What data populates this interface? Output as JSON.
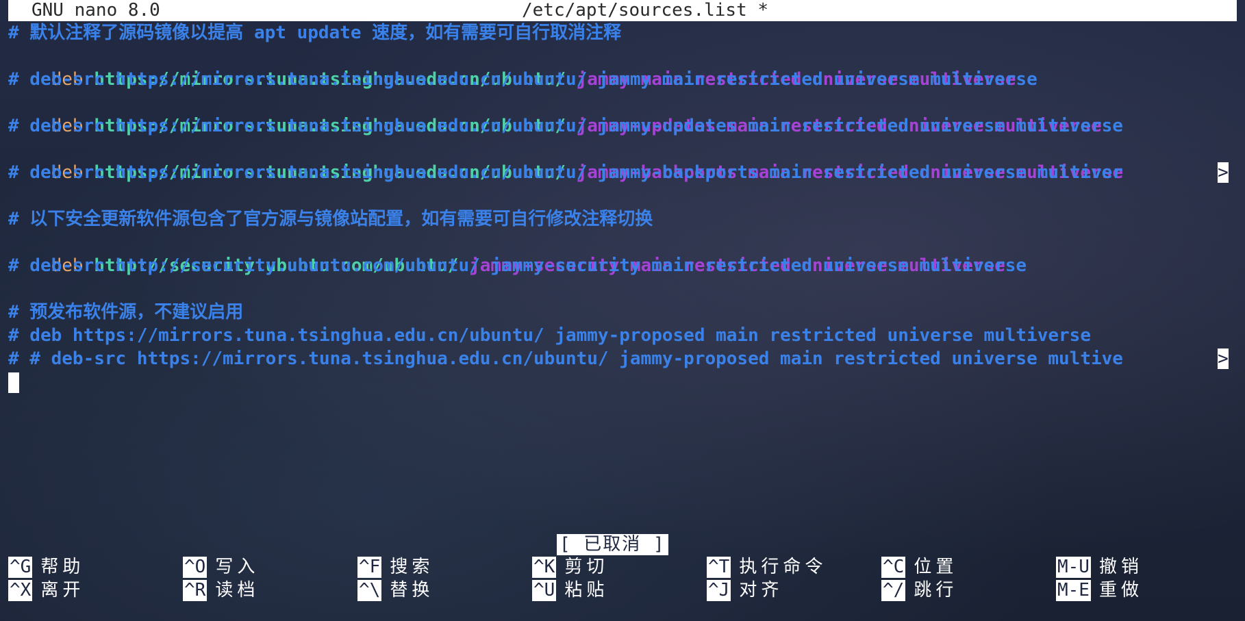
{
  "titlebar": {
    "app": "GNU nano 8.0",
    "file": "/etc/apt/sources.list *"
  },
  "lines": {
    "l1": "# 默认注释了源码镜像以提高 apt update 速度，如有需要可自行取消注释",
    "l2": {
      "deb": "deb",
      "url": "https://mirrors.tuna.tsinghua.edu.cn/ubuntu/",
      "dist": "jammy main restricted universe multiverse"
    },
    "l3": "# deb-src https://mirrors.tuna.tsinghua.edu.cn/ubuntu/ jammy main restricted universe multiverse",
    "l4": {
      "deb": "deb",
      "url": "https://mirrors.tuna.tsinghua.edu.cn/ubuntu/",
      "dist": "jammy-updates main restricted universe multiverse"
    },
    "l5": "# deb-src https://mirrors.tuna.tsinghua.edu.cn/ubuntu/ jammy-updates main restricted universe multiverse",
    "l6": {
      "deb": "deb",
      "url": "https://mirrors.tuna.tsinghua.edu.cn/ubuntu/",
      "dist": "jammy-backports main restricted universe multiverse"
    },
    "l7": "# deb-src https://mirrors.tuna.tsinghua.edu.cn/ubuntu/ jammy-backports main restricted universe multiver",
    "l9": "# 以下安全更新软件源包含了官方源与镜像站配置，如有需要可自行修改注释切换",
    "l10": {
      "deb": "deb",
      "url": "http://security.ubuntu.com/ubuntu/",
      "dist": "jammy-security main restricted universe multiverse"
    },
    "l11": "# deb-src http://security.ubuntu.com/ubuntu/ jammy-security main restricted universe multiverse",
    "l13": "# 预发布软件源，不建议启用",
    "l14": "# deb https://mirrors.tuna.tsinghua.edu.cn/ubuntu/ jammy-proposed main restricted universe multiverse",
    "l15": "# # deb-src https://mirrors.tuna.tsinghua.edu.cn/ubuntu/ jammy-proposed main restricted universe multive"
  },
  "overflow_marker": ">",
  "status": "[ 已取消 ]",
  "shortcuts": [
    {
      "key": "^G",
      "label": "帮助"
    },
    {
      "key": "^X",
      "label": "离开"
    },
    {
      "key": "^O",
      "label": "写入"
    },
    {
      "key": "^R",
      "label": "读档"
    },
    {
      "key": "^F",
      "label": "搜索"
    },
    {
      "key": "^\\",
      "label": "替换"
    },
    {
      "key": "^K",
      "label": "剪切"
    },
    {
      "key": "^U",
      "label": "粘贴"
    },
    {
      "key": "^T",
      "label": "执行命令"
    },
    {
      "key": "^J",
      "label": "对齐"
    },
    {
      "key": "^C",
      "label": "位置"
    },
    {
      "key": "^/",
      "label": "跳行"
    },
    {
      "key": "M-U",
      "label": "撤销"
    },
    {
      "key": "M-E",
      "label": "重做"
    }
  ],
  "colors": {
    "comment": "#3a82ea",
    "deb": "#e8a56a",
    "url": "#4fd1a8",
    "dist": "#a643d6"
  }
}
